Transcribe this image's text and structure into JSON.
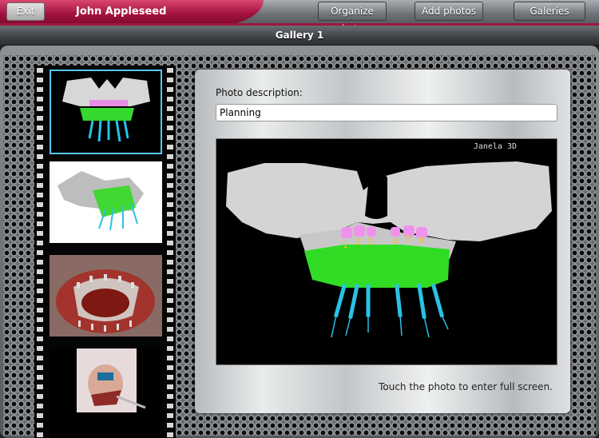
{
  "header": {
    "exit_label": "Exit",
    "user_name": "John Appleseed",
    "buttons": [
      "Organize photos",
      "Add photos",
      "Galeries"
    ]
  },
  "title": "Gallery 1",
  "photo_panel": {
    "description_label": "Photo description:",
    "description_value": "Planning",
    "watermark": "Janela 3D",
    "implant_labels": [
      "1",
      "2",
      "3",
      "4",
      "5",
      "6"
    ],
    "hint": "Touch the photo to enter full screen."
  },
  "film_strip": {
    "thumbnails": [
      "jaw-3d-frontal",
      "jaw-3d-oblique",
      "surgical-implants",
      "patient-procedure"
    ],
    "selected_index": 0
  },
  "colors": {
    "brand_red": "#a3123f",
    "selection_blue": "#58c7ef",
    "guide_green": "#2ecc22",
    "implant_cyan": "#29c2e6"
  }
}
